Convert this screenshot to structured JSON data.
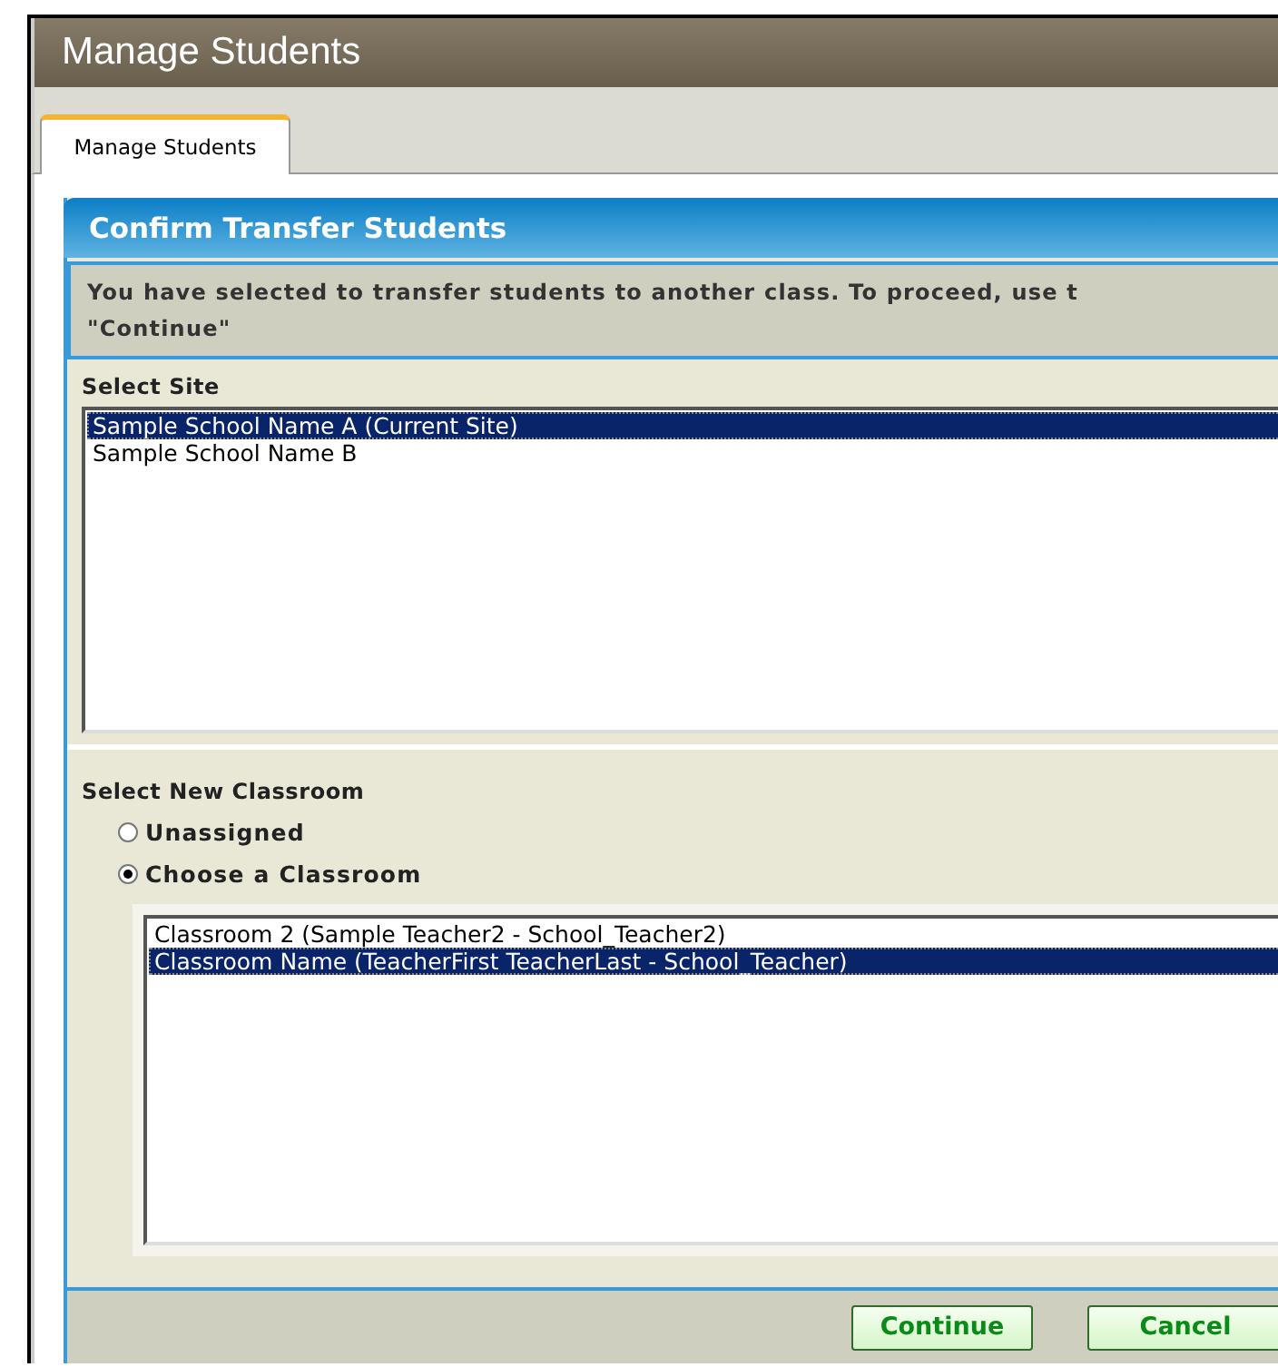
{
  "window": {
    "title": "Manage Students"
  },
  "tabs": [
    {
      "label": "Manage Students",
      "selected": true
    }
  ],
  "panel": {
    "title": "Confirm Transfer Students",
    "message_lines": [
      "You have selected to transfer students to another class. To proceed, use t",
      "\"Continue\""
    ],
    "site": {
      "label": "Select Site",
      "options": [
        {
          "label": "Sample School Name A (Current Site)",
          "selected": true
        },
        {
          "label": "Sample School Name B",
          "selected": false
        }
      ]
    },
    "classroom": {
      "label": "Select New Classroom",
      "radios": [
        {
          "label": "Unassigned",
          "selected": false
        },
        {
          "label": "Choose a Classroom",
          "selected": true
        }
      ],
      "options": [
        {
          "label": "Classroom 2 (Sample Teacher2 - School_Teacher2)",
          "selected": false
        },
        {
          "label": "Classroom Name (TeacherFirst TeacherLast - School_Teacher)",
          "selected": true
        }
      ]
    },
    "buttons": [
      "Continue",
      "Cancel"
    ]
  }
}
